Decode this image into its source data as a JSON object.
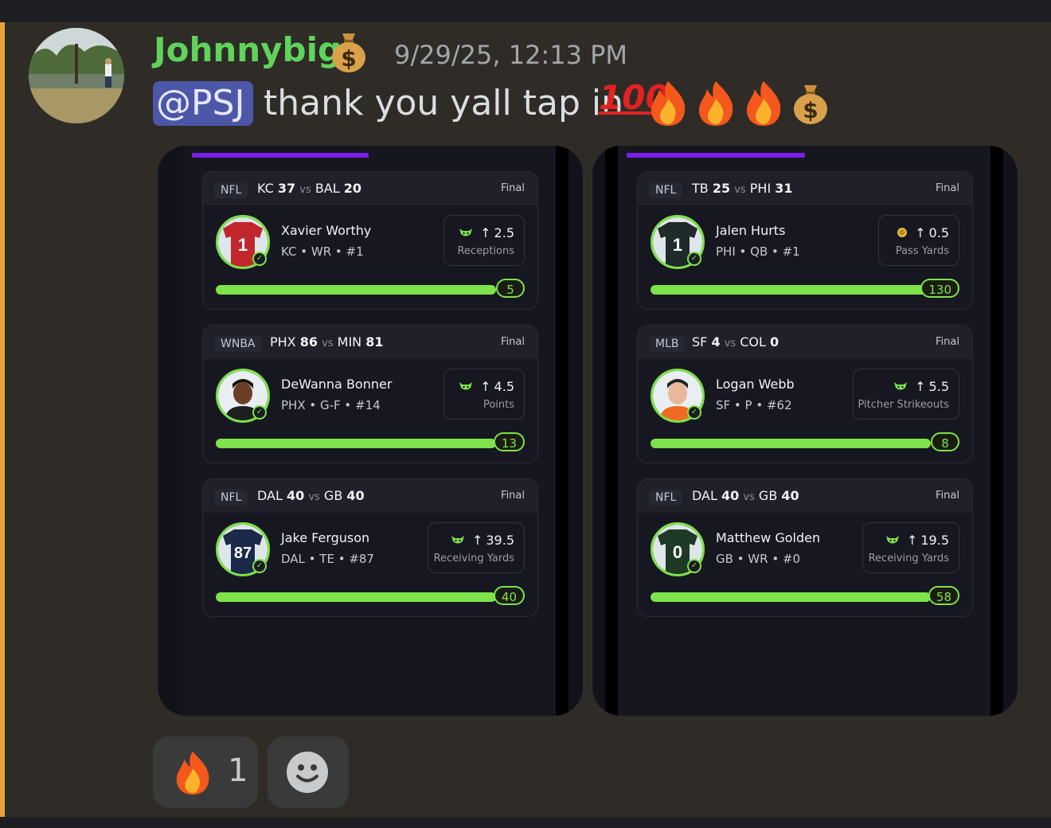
{
  "message": {
    "username": "Johnnybig",
    "username_emoji": "money-bag",
    "timestamp": "9/29/25, 12:13 PM",
    "mention": "@PSJ",
    "text": "thank you yall tap in",
    "trailing_emojis": [
      "100",
      "fire",
      "fire",
      "fire",
      "money-bag"
    ]
  },
  "screenshots": [
    {
      "cards": [
        {
          "league": "NFL",
          "team1": "KC",
          "score1": "37",
          "vs": "vs",
          "team2": "BAL",
          "score2": "20",
          "status": "Final",
          "player": "Xavier Worthy",
          "info": "KC • WR • #1",
          "jersey_number": "1",
          "jersey_color": "#c1272d",
          "pick_icon": "goblin-icon",
          "line": "2.5",
          "stat": "Receptions",
          "result": "5",
          "fill": 1.0
        },
        {
          "league": "WNBA",
          "team1": "PHX",
          "score1": "86",
          "vs": "vs",
          "team2": "MIN",
          "score2": "81",
          "status": "Final",
          "player": "DeWanna Bonner",
          "info": "PHX • G-F • #14",
          "jersey_number": "",
          "jersey_color": "#f2f2f2",
          "pick_icon": "goblin-icon",
          "line": "4.5",
          "stat": "Points",
          "result": "13",
          "fill": 1.0
        },
        {
          "league": "NFL",
          "team1": "DAL",
          "score1": "40",
          "vs": "vs",
          "team2": "GB",
          "score2": "40",
          "status": "Final",
          "player": "Jake Ferguson",
          "info": "DAL • TE • #87",
          "jersey_number": "87",
          "jersey_color": "#1b2a4a",
          "pick_icon": "goblin-icon",
          "line": "39.5",
          "stat": "Receiving Yards",
          "result": "40",
          "fill": 1.0
        }
      ]
    },
    {
      "cards": [
        {
          "league": "NFL",
          "team1": "TB",
          "score1": "25",
          "vs": "vs",
          "team2": "PHI",
          "score2": "31",
          "status": "Final",
          "player": "Jalen Hurts",
          "info": "PHI • QB • #1",
          "jersey_number": "1",
          "jersey_color": "#1f2a2a",
          "pick_icon": "coin-icon",
          "line": "0.5",
          "stat": "Pass Yards",
          "result": "130",
          "fill": 1.0
        },
        {
          "league": "MLB",
          "team1": "SF",
          "score1": "4",
          "vs": "vs",
          "team2": "COL",
          "score2": "0",
          "status": "Final",
          "player": "Logan Webb",
          "info": "SF • P • #62",
          "jersey_number": "",
          "jersey_color": "#e8e8e8",
          "pick_icon": "goblin-icon",
          "line": "5.5",
          "stat": "Pitcher Strikeouts",
          "result": "8",
          "fill": 1.0
        },
        {
          "league": "NFL",
          "team1": "DAL",
          "score1": "40",
          "vs": "vs",
          "team2": "GB",
          "score2": "40",
          "status": "Final",
          "player": "Matthew Golden",
          "info": "GB • WR • #0",
          "jersey_number": "0",
          "jersey_color": "#1e3a26",
          "pick_icon": "goblin-icon",
          "line": "19.5",
          "stat": "Receiving Yards",
          "result": "58",
          "fill": 1.0
        }
      ]
    }
  ],
  "reactions": [
    {
      "emoji": "fire",
      "count": "1"
    },
    {
      "emoji": "add-reaction",
      "count": ""
    }
  ],
  "colors": {
    "accent": "#e7a23a",
    "username": "#5fd35c",
    "progress": "#7ee34a",
    "tab_indicator": "#7a1fe8",
    "mention_bg": "#4c57a8"
  }
}
